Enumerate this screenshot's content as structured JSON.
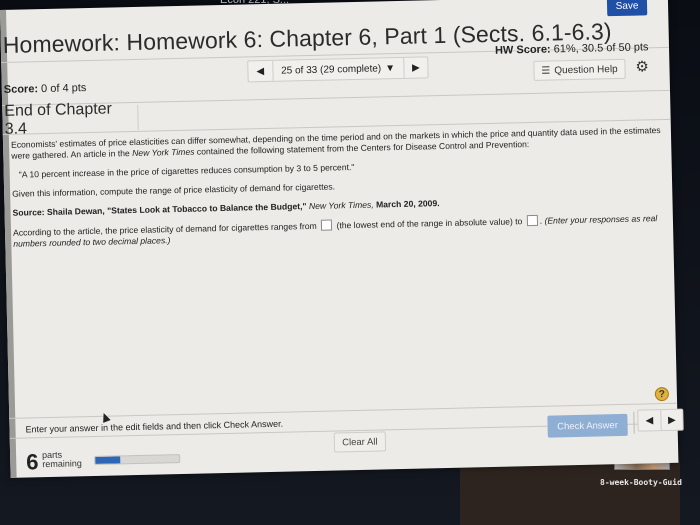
{
  "os": {
    "menubar_text": "Econ 221, S..."
  },
  "header": {
    "title": "Homework: Homework 6: Chapter 6, Part 1 (Sects. 6.1-6.3)",
    "save_label": "Save",
    "score_label": "Score:",
    "score_value": "0 of 4 pts",
    "nav": {
      "prev_icon": "◀",
      "position": "25 of 33 (29 complete)",
      "dropdown_icon": "▼",
      "next_icon": "▶"
    },
    "hw_score_label": "HW Score:",
    "hw_score_value": "61%, 30.5 of 50 pts",
    "question_help_label": "Question Help",
    "question_help_icon": "☰",
    "settings_icon": "⚙"
  },
  "question": {
    "section_label": "End of Chapter 3.4",
    "intro_part1": "Economists' estimates of price elasticities can differ somewhat, depending on the time period and on the markets in which the price and quantity data used in the estimates were gathered. An article in the ",
    "intro_italic": "New York Times",
    "intro_part2": " contained the following statement from the Centers for Disease Control and Prevention:",
    "quote": "\"A 10 percent increase in the price of cigarettes reduces consumption by 3 to 5 percent.\"",
    "given": "Given this information, compute the range of price elasticity of demand for cigarettes.",
    "source_bold": "Source: Shaila Dewan, \"States Look at Tobacco to Balance the Budget,\"",
    "source_italic": " New York Times,",
    "source_date": " March 20, 2009.",
    "prompt_part1": "According to the article, the price elasticity of demand for cigarettes ranges from",
    "prompt_part2": "(the lowest end of the range in absolute value) to",
    "prompt_part3": ".",
    "prompt_instructions": "(Enter your responses as real numbers rounded to two decimal places.)",
    "answer_low_value": "",
    "answer_high_value": ""
  },
  "footer": {
    "help_icon": "?",
    "instruction": "Enter your answer in the edit fields and then click Check Answer.",
    "parts_remaining_count": "6",
    "parts_remaining_line1": "parts",
    "parts_remaining_line2": "remaining",
    "progress_fraction": 0.3,
    "clear_all_label": "Clear All",
    "check_answer_label": "Check Answer",
    "prev_icon": "◀",
    "next_icon": "▶"
  },
  "desktop": {
    "file_label": "8-week-Booty-Guid"
  },
  "colors": {
    "save_button": "#1f4fa6",
    "check_answer_button": "#8eaed4",
    "progress_fill": "#2d67b8",
    "help_badge": "#e0b23c"
  }
}
